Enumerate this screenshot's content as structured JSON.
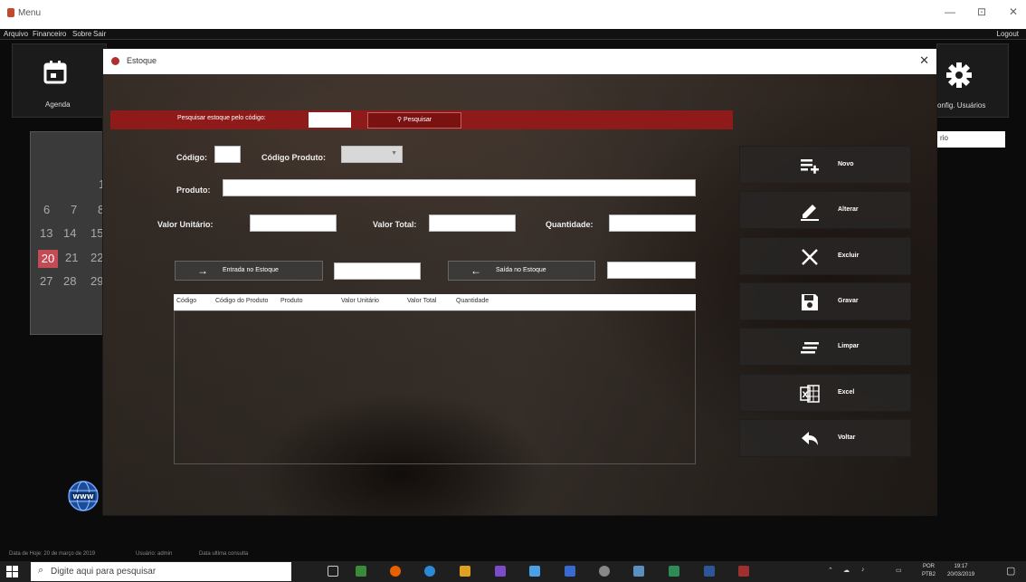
{
  "window": {
    "title": "Menu",
    "minimize": "—",
    "maximize": "⊡",
    "close": "✕"
  },
  "menubar": {
    "items": [
      "Arquivo",
      "Financeiro",
      "Sobre",
      "Sair"
    ],
    "logout": "Logout"
  },
  "background": {
    "agenda_label": "Agenda",
    "config_label": "onfig. Usuários",
    "side_input_text": "rio",
    "calendar_days": [
      {
        "t": "1"
      },
      {
        "t": "6"
      },
      {
        "t": "7"
      },
      {
        "t": "8"
      },
      {
        "t": "13"
      },
      {
        "t": "14"
      },
      {
        "t": "15"
      },
      {
        "t": "21"
      },
      {
        "t": "22"
      },
      {
        "t": "27"
      },
      {
        "t": "28"
      },
      {
        "t": "29"
      }
    ],
    "today": "20",
    "statusbar": [
      "Data de Hoje: 20 de março de 2019",
      "Usuário: admin",
      "Data ultima consulta"
    ]
  },
  "dialog": {
    "title": "Estoque",
    "close": "✕",
    "search": {
      "label": "Pesquisar estoque pelo código:",
      "button": "Pesquisar",
      "value": ""
    },
    "fields": {
      "codigo": "Código:",
      "codigo_produto": "Código Produto:",
      "produto": "Produto:",
      "valor_unitario": "Valor Unitário:",
      "valor_total": "Valor Total:",
      "quantidade": "Quantidade:"
    },
    "entrada": "Entrada no Estoque",
    "saida": "Saída no Estoque",
    "grid_columns": [
      "Código",
      "Código do Produto",
      "Produto",
      "Valor Unitário",
      "Valor Total",
      "Quantidade"
    ],
    "actions": [
      {
        "label": "Novo",
        "icon": "add-list-icon"
      },
      {
        "label": "Alterar",
        "icon": "pencil-icon"
      },
      {
        "label": "Excluir",
        "icon": "x-icon"
      },
      {
        "label": "Gravar",
        "icon": "save-icon"
      },
      {
        "label": "Limpar",
        "icon": "clear-lines-icon"
      },
      {
        "label": "Excel",
        "icon": "excel-icon"
      },
      {
        "label": "Voltar",
        "icon": "back-arrow-icon"
      }
    ]
  },
  "taskbar": {
    "search_placeholder": "Digite aqui para pesquisar",
    "language": "POR",
    "language_sub": "PTB2",
    "time": "19:17",
    "date": "20/03/2019"
  },
  "colors": {
    "accent_red": "#8e1a1a",
    "today_red": "#c24b55"
  }
}
